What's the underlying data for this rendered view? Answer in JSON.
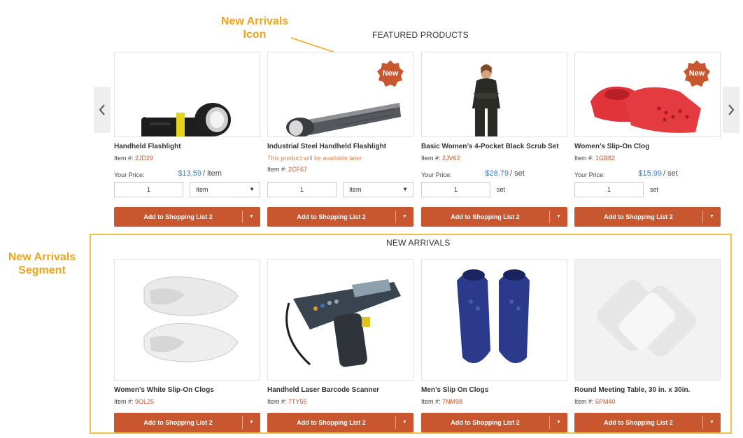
{
  "annotations": {
    "new_arrivals_icon": [
      "New Arrivals",
      "Icon"
    ],
    "new_arrivals_segment": [
      "New Arrivals",
      "Segment"
    ]
  },
  "featured": {
    "title": "FEATURED PRODUCTS",
    "products": [
      {
        "name": "Handheld Flashlight",
        "item_label": "Item #: ",
        "item_code": "2JD29",
        "price_label": "Your Price:",
        "price": "$13.59",
        "unit": "/ item",
        "qty": "1",
        "uom": "Item",
        "button": "Add to Shopping List 2"
      },
      {
        "name": "Industrial Steel Handheld Flashlight",
        "availability": "This product will be available later",
        "item_label": "Item #: ",
        "item_code": "2CF67",
        "qty": "1",
        "uom": "Item",
        "badge": "New",
        "button": "Add to Shopping List 2"
      },
      {
        "name": "Basic Women’s 4-Pocket Black Scrub Set",
        "item_label": "Item #: ",
        "item_code": "2JV62",
        "price_label": "Your Price:",
        "price": "$28.79",
        "unit": "/ set",
        "qty": "1",
        "uom": "set",
        "button": "Add to Shopping List 2"
      },
      {
        "name": "Women’s Slip-On Clog",
        "item_label": "Item #: ",
        "item_code": "1GB82",
        "price_label": "Your Price:",
        "price": "$15.99",
        "unit": "/ set",
        "qty": "1",
        "uom": "set",
        "badge": "New",
        "button": "Add to Shopping List 2"
      }
    ]
  },
  "new_arrivals": {
    "title": "NEW ARRIVALS",
    "products": [
      {
        "name": "Women’s White Slip-On Clogs",
        "item_label": "Item #: ",
        "item_code": "9OL25",
        "button": "Add to Shopping List 2"
      },
      {
        "name": "Handheld Laser Barcode Scanner",
        "item_label": "Item #: ",
        "item_code": "7TY55",
        "button": "Add to Shopping List 2"
      },
      {
        "name": "Men’s Slip On Clogs",
        "item_label": "Item #: ",
        "item_code": "7NM98",
        "button": "Add to Shopping List 2"
      },
      {
        "name": "Round Meeting Table, 30 in. x 30in.",
        "item_label": "Item #: ",
        "item_code": "6PM40",
        "button": "Add to Shopping List 2"
      }
    ]
  },
  "colors": {
    "accent": "#c8562e",
    "price": "#3b7dbf",
    "annotation": "#f0a41c"
  },
  "icons": {
    "prev": "chevron-left-icon",
    "next": "chevron-right-icon",
    "dropdown": "caret-down-icon"
  }
}
